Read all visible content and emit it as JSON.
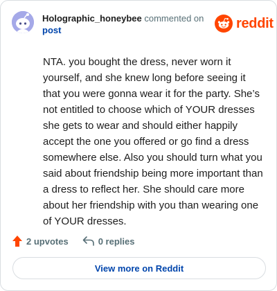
{
  "header": {
    "username": "Holographic_honeybee",
    "action_text": "commented on",
    "post_link": "post",
    "brand_name": "reddit"
  },
  "comment": {
    "body": "NTA. you bought the dress, never worn it yourself, and she knew long before seeing it that you were gonna wear it for the party. She’s not entitled to choose which of YOUR dresses she gets to wear and should either happily accept the one you offered or go find a dress somewhere else. Also you should turn what you said about friendship being more important than a dress to reflect her. She should care more about her friendship with you than wearing one of YOUR dresses."
  },
  "stats": {
    "upvotes": "2 upvotes",
    "replies": "0 replies"
  },
  "footer": {
    "view_more_label": "View more on Reddit"
  },
  "icons": {
    "avatar": "snoo-avatar-icon",
    "brand": "reddit-logo-icon",
    "upvote": "upvote-arrow-icon",
    "reply": "reply-arrow-icon"
  },
  "colors": {
    "brand": "#ff4500",
    "link": "#0045ac",
    "muted": "#576f76",
    "avatar_bg": "#a5a9e8",
    "upvote": "#ff4500",
    "border": "#d9dde1"
  }
}
